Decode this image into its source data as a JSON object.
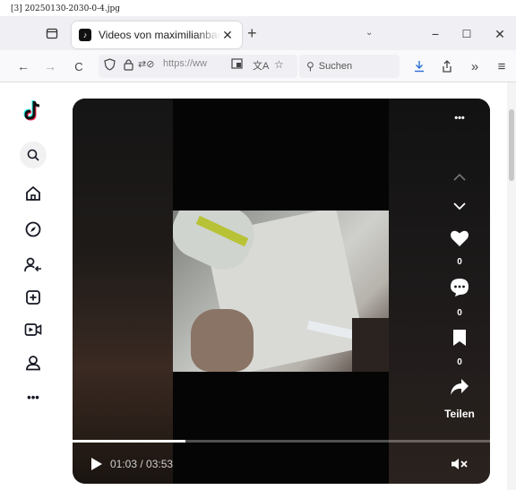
{
  "caption": "[3] 20250130-2030-0-4.jpg",
  "tab": {
    "title": "Videos von maximilianbaehring",
    "close": "✕",
    "new_tab": "+",
    "list_menu": "⌄"
  },
  "window": {
    "minimize": "−",
    "maximize": "☐",
    "close": "✕"
  },
  "navbar": {
    "back": "←",
    "forward": "→",
    "reload": "C",
    "url_text": "https://ww",
    "search_placeholder": "Suchen",
    "extensions": "»",
    "menu": "≡"
  },
  "sidebar": {
    "items": [
      "tiktok-logo",
      "search",
      "home",
      "explore",
      "following",
      "upload",
      "live",
      "profile",
      "more"
    ]
  },
  "player": {
    "more": "•••",
    "likes": "0",
    "comments": "0",
    "saves": "0",
    "share_label": "Teilen",
    "current_time": "01:03",
    "duration": "03:53",
    "time_separator": " / ",
    "progress": 0.27
  }
}
